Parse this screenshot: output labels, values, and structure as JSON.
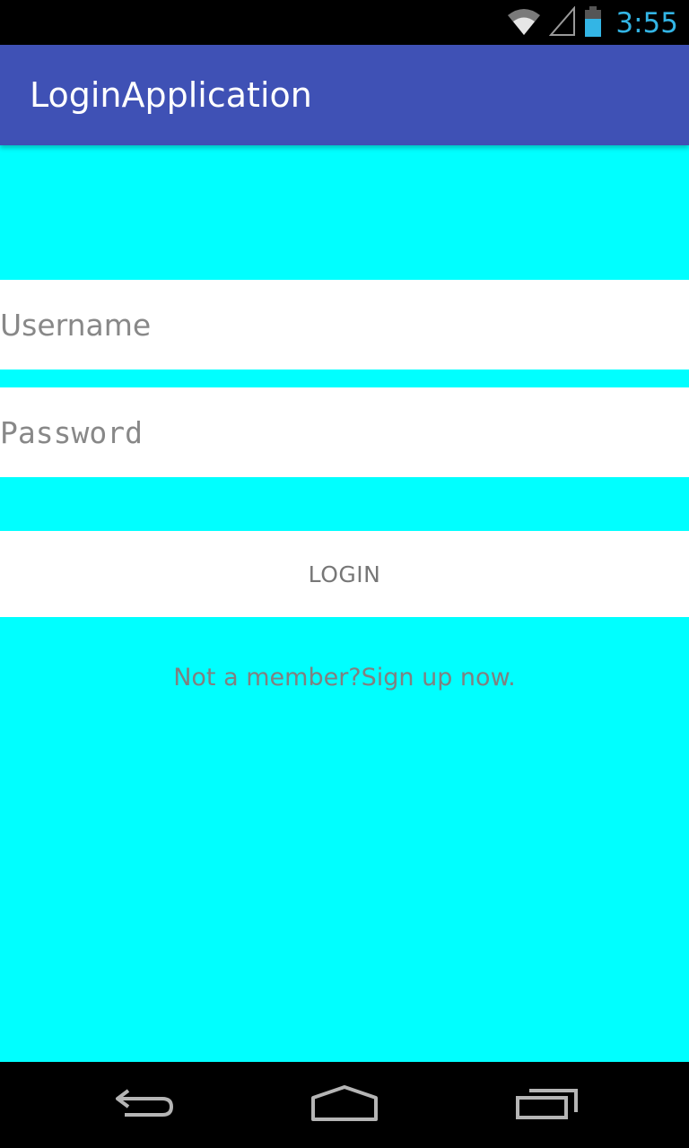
{
  "status_bar": {
    "time": "3:55",
    "icons": [
      "wifi-icon",
      "signal-icon",
      "battery-icon"
    ],
    "clock_color": "#33b5e5"
  },
  "app_bar": {
    "title": "LoginApplication",
    "color": "#3f51b5"
  },
  "form": {
    "background_color": "#00ffff",
    "username": {
      "placeholder": "Username",
      "value": ""
    },
    "password": {
      "placeholder": "Password",
      "value": ""
    },
    "login_label": "LOGIN",
    "signup_text": "Not a member?Sign up now."
  },
  "nav_bar": {
    "buttons": [
      "back-icon",
      "home-icon",
      "recents-icon"
    ]
  }
}
